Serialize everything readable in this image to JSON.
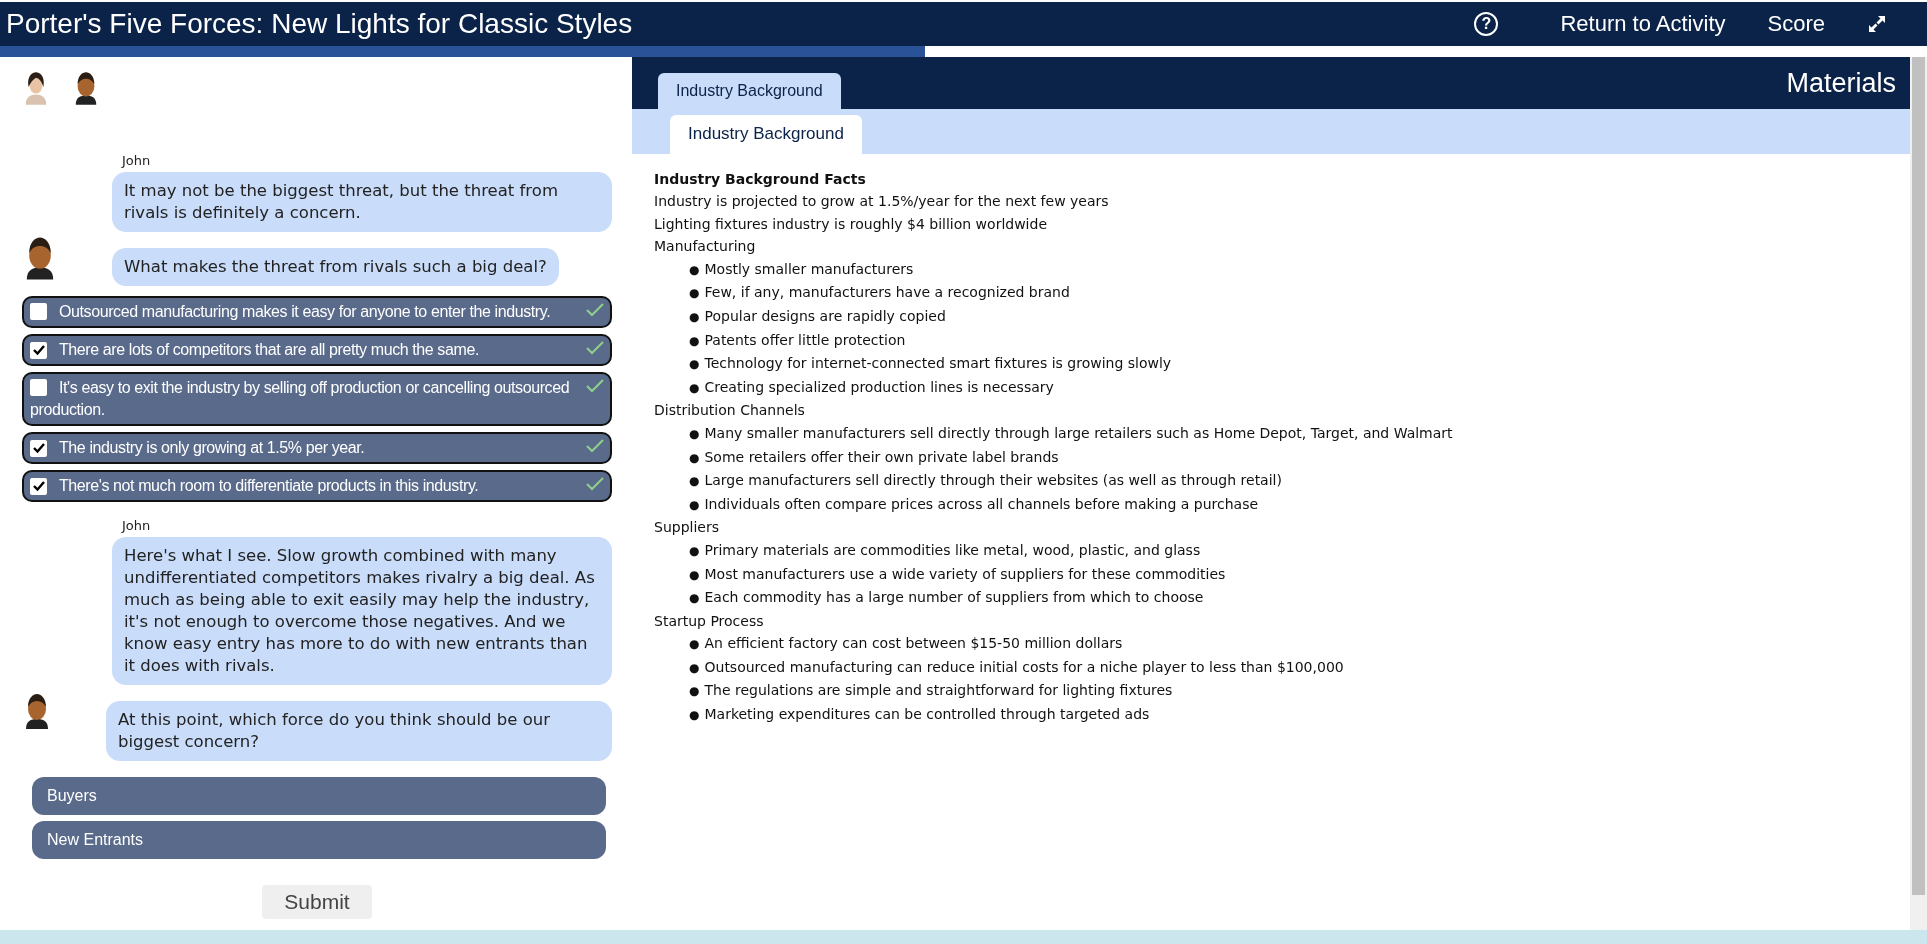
{
  "header": {
    "title": "Porter's Five Forces: New Lights for Classic Styles",
    "help": "?",
    "links": [
      "Return to Activity",
      "Score"
    ]
  },
  "progress": {
    "level": 0.48
  },
  "chat": [
    {
      "kind": "player",
      "speaker": "John",
      "text": "It may not be the biggest threat, but the threat from rivals is definitely a concern."
    },
    {
      "kind": "npc",
      "text": "What makes the threat from rivals such a big deal?"
    },
    {
      "kind": "checklist",
      "options": [
        {
          "text": "Outsourced manufacturing makes it easy for anyone to enter the industry.",
          "checked": false,
          "correct": true
        },
        {
          "text": "There are lots of competitors that are all pretty much the same.",
          "checked": true,
          "correct": true
        },
        {
          "text": "It's easy to exit the industry by selling off production or cancelling outsourced production.",
          "checked": false,
          "correct": true
        },
        {
          "text": "The industry is only growing at 1.5% per year.",
          "checked": true,
          "correct": true
        },
        {
          "text": "There's not much room to differentiate products in this industry.",
          "checked": true,
          "correct": true
        }
      ]
    },
    {
      "kind": "player",
      "speaker": "John",
      "text": "Here's what I see. Slow growth combined with many undifferentiated competitors makes rivalry a big deal. As much as being able to exit easily may help the industry, it's not enough to overcome those negatives. And we know easy entry has more to do with new entrants than it does with rivals."
    },
    {
      "kind": "npc",
      "text": "At this point, which force do you think should be our biggest concern?"
    },
    {
      "kind": "choices",
      "options": [
        {
          "label": "Buyers",
          "selected": false
        },
        {
          "label": "New Entrants",
          "selected": false
        }
      ]
    }
  ],
  "submit": "Submit",
  "materials": {
    "title": "Materials",
    "tabs": [
      {
        "label": "Industry Background",
        "selected": true
      }
    ],
    "subtabs": [
      {
        "label": "Industry Background",
        "selected": true
      }
    ],
    "heading": "Industry Background Facts",
    "bullet": "●",
    "lines": [
      "Industry is projected to grow at 1.5%/year for the next few years",
      "Lighting fixtures industry is roughly $4 billion worldwide"
    ],
    "sections": [
      {
        "title": "Manufacturing",
        "items": [
          "Mostly smaller manufacturers",
          "Few, if any, manufacturers have a recognized brand",
          "Popular designs are rapidly copied",
          "Patents offer little protection",
          "Technology for internet-connected smart fixtures is growing slowly",
          "Creating specialized production lines is necessary"
        ]
      },
      {
        "title": "Distribution Channels",
        "items": [
          "Many smaller manufacturers sell directly through large retailers such as Home Depot, Target, and Walmart",
          "Some retailers offer their own private label brands",
          "Large manufacturers sell directly through their websites (as well as through retail)",
          "Individuals often compare prices across all channels before making a purchase"
        ]
      },
      {
        "title": "Suppliers",
        "items": [
          "Primary materials are commodities like metal, wood, plastic, and glass",
          "Most manufacturers use a wide variety of suppliers for these commodities",
          "Each commodity has a large number of suppliers from which to choose"
        ]
      },
      {
        "title": "Startup Process",
        "items": [
          "An efficient factory can cost between $15-50 million dollars",
          "Outsourced manufacturing can reduce initial costs for a niche player to less than $100,000",
          "The regulations are simple and straightforward for lighting fixtures",
          "Marketing expenditures can be controlled through targeted ads"
        ]
      }
    ]
  }
}
